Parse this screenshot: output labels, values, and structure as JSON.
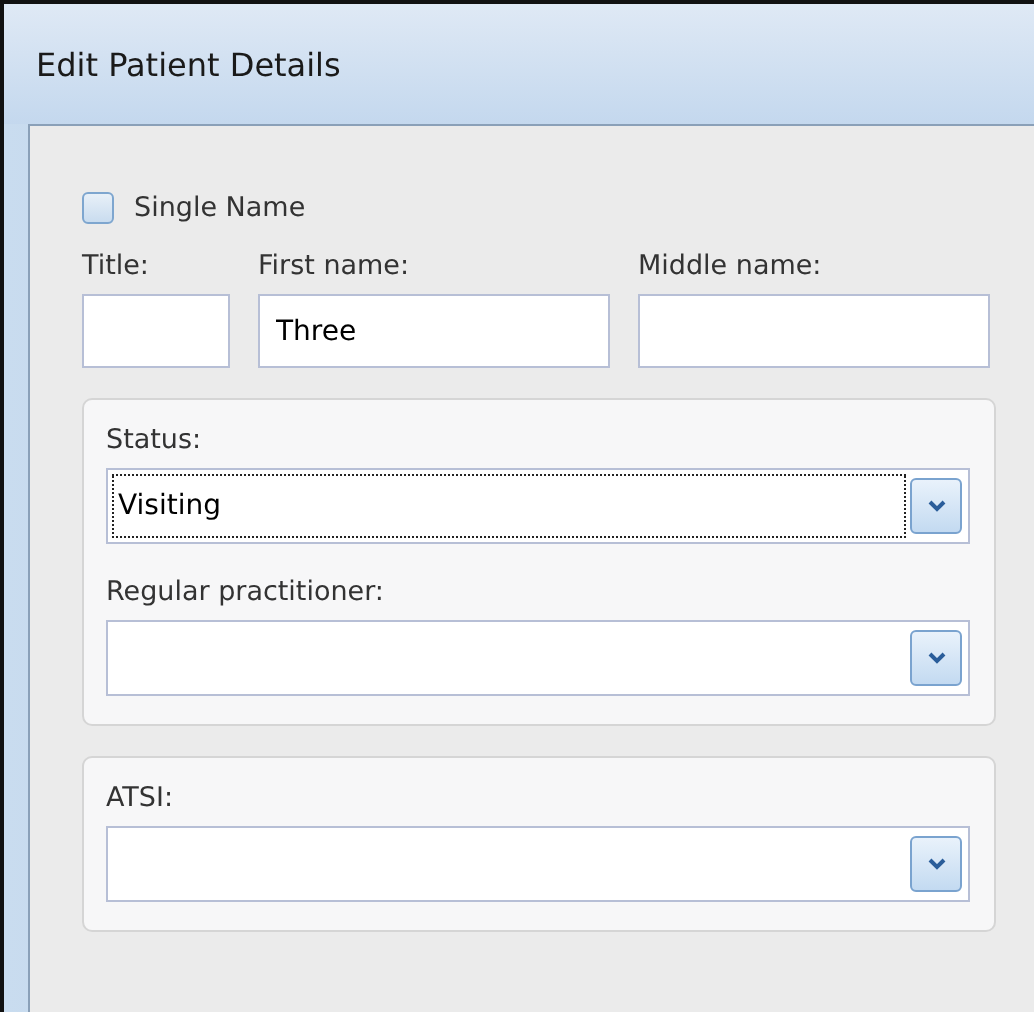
{
  "window": {
    "title": "Edit Patient Details"
  },
  "single_name": {
    "label": "Single Name",
    "checked": false
  },
  "name_fields": [
    {
      "label": "Title:"
    },
    {
      "label": "First name:",
      "value": "Three"
    },
    {
      "label": "Middle name:"
    }
  ],
  "panels": [
    {
      "combos": [
        {
          "label": "Status:",
          "value": "Visiting",
          "focused": true
        },
        {
          "label": "Regular practitioner:",
          "focused": false
        }
      ]
    },
    {
      "combos": [
        {
          "label": "ATSI:",
          "focused": false
        }
      ]
    }
  ]
}
